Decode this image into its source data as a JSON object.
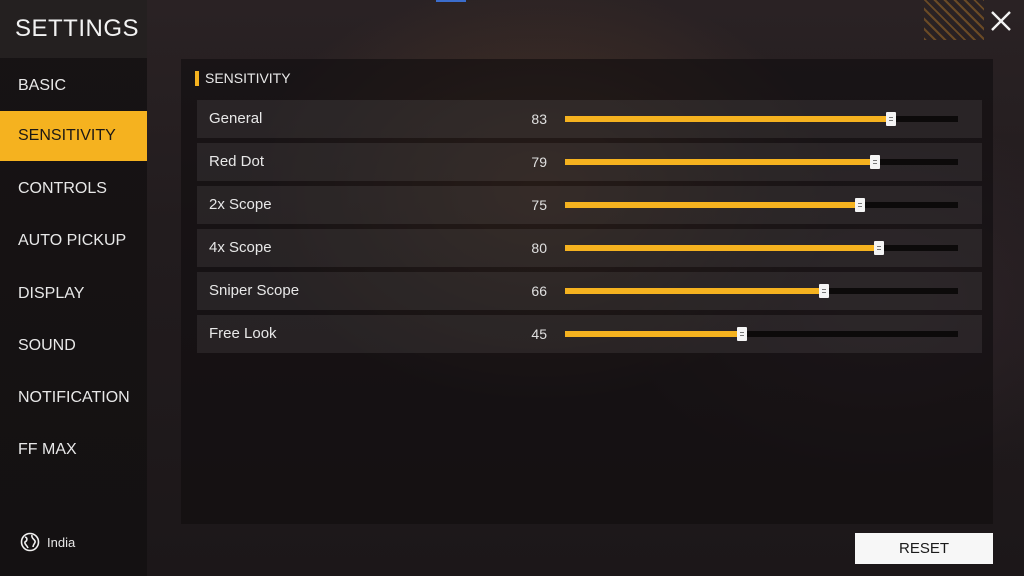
{
  "title": "SETTINGS",
  "nav": {
    "items": [
      {
        "label": "BASIC",
        "active": false
      },
      {
        "label": "SENSITIVITY",
        "active": true
      },
      {
        "label": "CONTROLS",
        "active": false
      },
      {
        "label": "AUTO PICKUP",
        "active": false
      },
      {
        "label": "DISPLAY",
        "active": false
      },
      {
        "label": "SOUND",
        "active": false
      },
      {
        "label": "NOTIFICATION",
        "active": false
      },
      {
        "label": "FF MAX",
        "active": false
      }
    ]
  },
  "region": {
    "label": "India",
    "icon": "globe-icon"
  },
  "section": {
    "title": "SENSITIVITY"
  },
  "sliders": [
    {
      "label": "General",
      "value": 83
    },
    {
      "label": "Red Dot",
      "value": 79
    },
    {
      "label": "2x Scope",
      "value": 75
    },
    {
      "label": "4x Scope",
      "value": 80
    },
    {
      "label": "Sniper Scope",
      "value": 66
    },
    {
      "label": "Free Look",
      "value": 45
    }
  ],
  "reset": {
    "label": "RESET"
  },
  "close": {
    "icon": "close-icon"
  },
  "colors": {
    "accent": "#f5b21f",
    "track": "#0c0a0a",
    "thumb": "#f4f4f4"
  }
}
